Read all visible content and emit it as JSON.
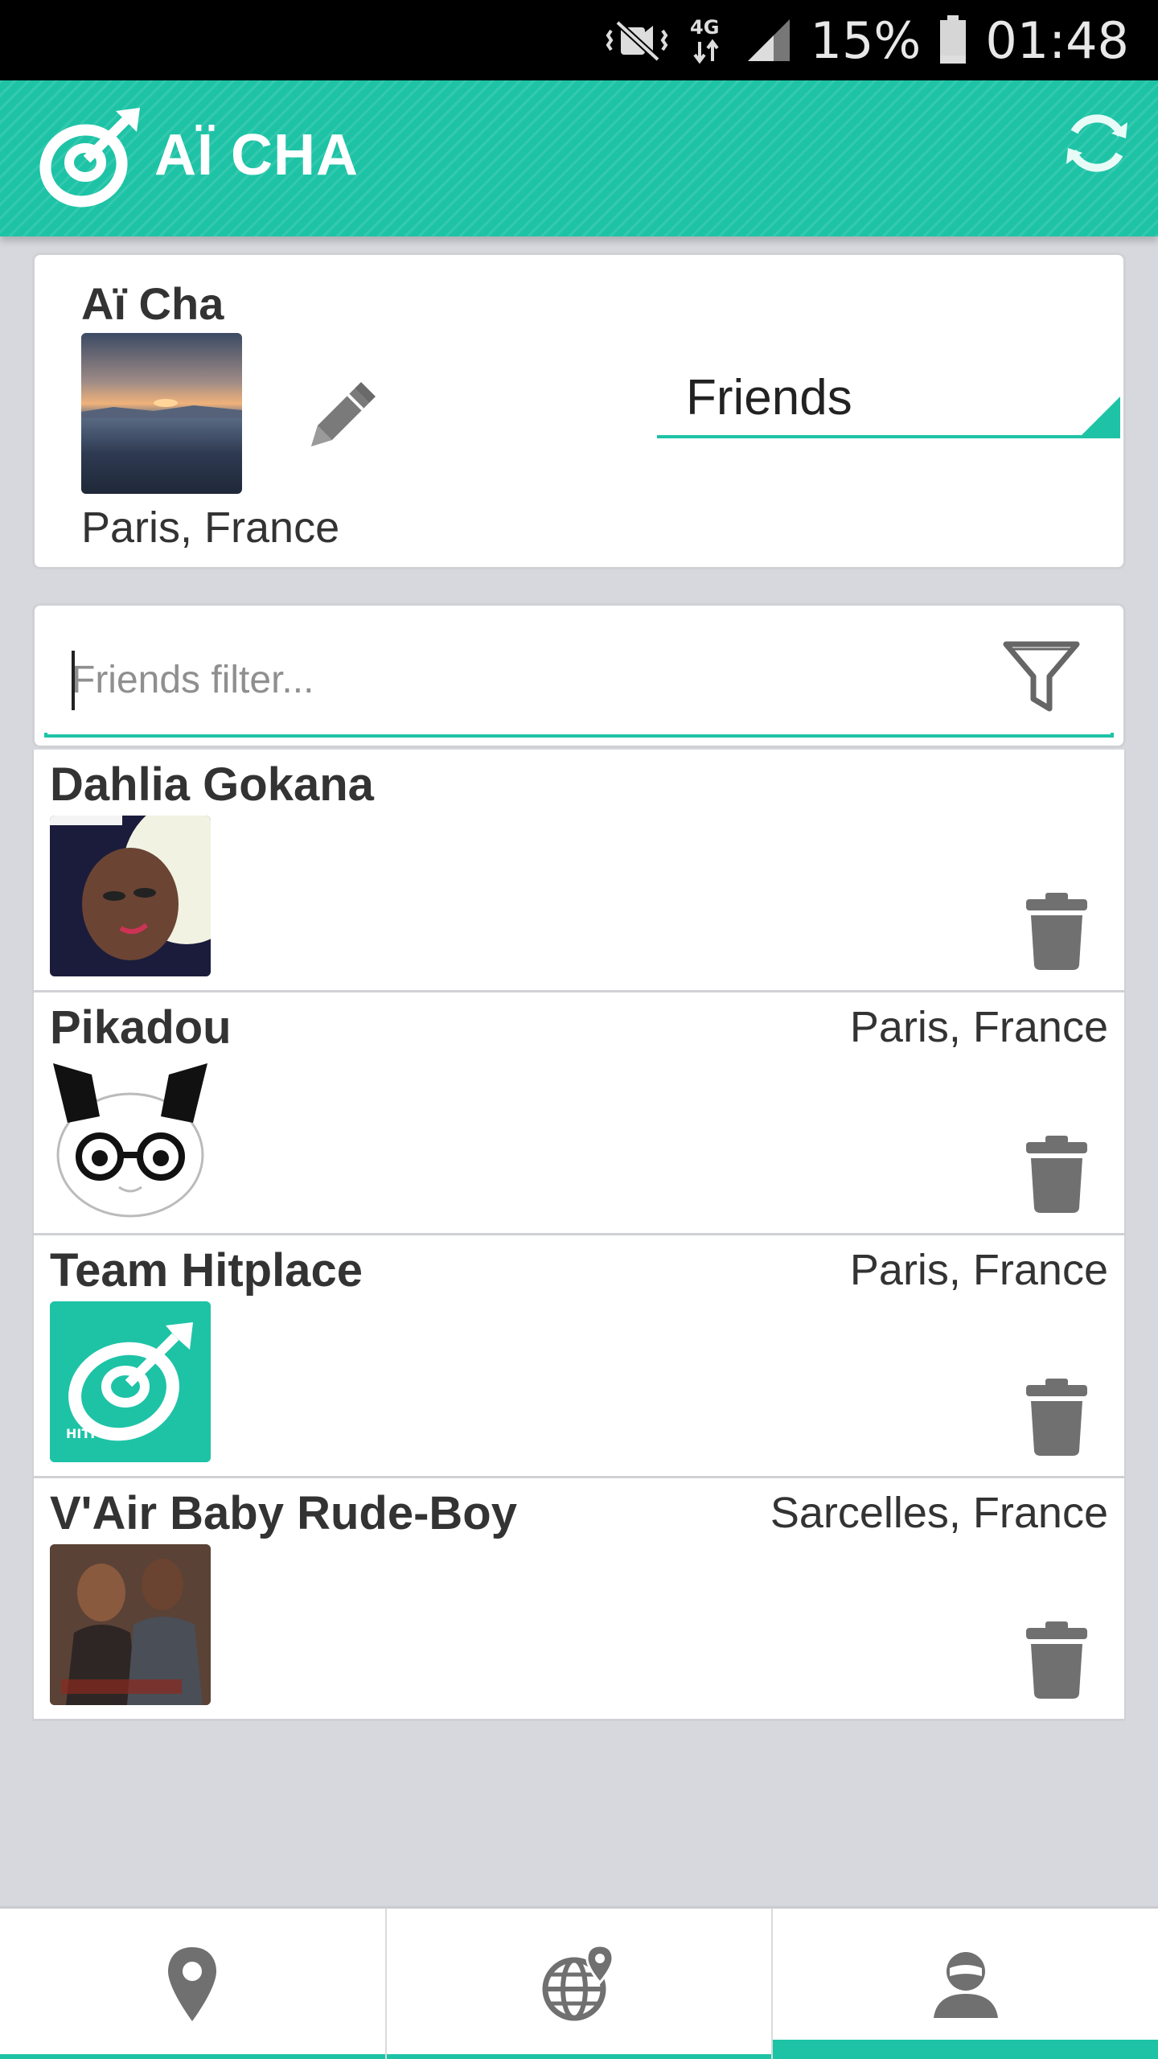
{
  "status_bar": {
    "battery_percent": "15%",
    "time": "01:48",
    "network": "4G",
    "icons": [
      "vibrate-mute-icon",
      "network-4g-icon",
      "signal-icon",
      "battery-icon"
    ]
  },
  "app_bar": {
    "title": "AÏ CHA",
    "logo_icon": "dart-target-logo-icon",
    "refresh_icon": "refresh-icon"
  },
  "profile": {
    "name": "Aï Cha",
    "location": "Paris, France",
    "edit_icon": "pencil-icon",
    "group_selected": "Friends"
  },
  "filter": {
    "placeholder": "Friends filter...",
    "value": "",
    "icon": "funnel-filter-icon"
  },
  "friends": [
    {
      "name": "Dahlia Gokana",
      "location": ""
    },
    {
      "name": "Pikadou",
      "location": "Paris, France"
    },
    {
      "name": "Team Hitplace",
      "location": "Paris, France"
    },
    {
      "name": "V'Air Baby Rude-Boy",
      "location": "Sarcelles, France"
    }
  ],
  "bottom_nav": {
    "tabs": [
      {
        "icon": "map-pin-icon",
        "active": false
      },
      {
        "icon": "globe-pin-icon",
        "active": false
      },
      {
        "icon": "person-icon",
        "active": true
      }
    ]
  },
  "colors": {
    "accent": "#1ec3a6",
    "background": "#d6d8dd",
    "text": "#333333",
    "icon_gray": "#707070"
  }
}
